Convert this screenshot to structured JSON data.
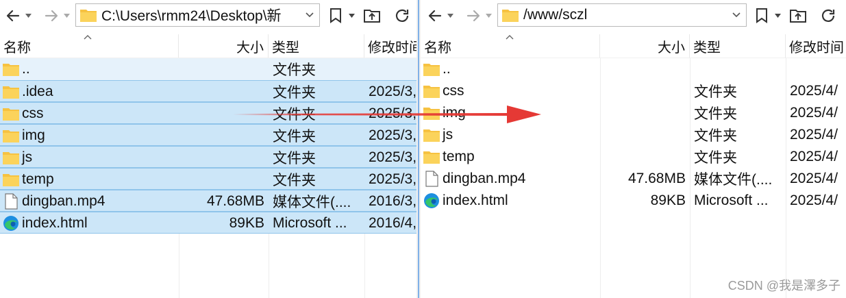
{
  "left": {
    "address": "C:\\Users\\rmm24\\Desktop\\新",
    "columns": {
      "name": "名称",
      "size": "大小",
      "type": "类型",
      "date": "修改时间"
    },
    "rows": [
      {
        "name": "..",
        "size": "",
        "type": "文件夹",
        "date": "",
        "icon": "folder-icon",
        "state": "parent"
      },
      {
        "name": ".idea",
        "size": "",
        "type": "文件夹",
        "date": "2025/3,",
        "icon": "folder-icon",
        "state": "selected"
      },
      {
        "name": "css",
        "size": "",
        "type": "文件夹",
        "date": "2025/3,",
        "icon": "folder-icon",
        "state": "selected"
      },
      {
        "name": "img",
        "size": "",
        "type": "文件夹",
        "date": "2025/3,",
        "icon": "folder-icon",
        "state": "selected"
      },
      {
        "name": "js",
        "size": "",
        "type": "文件夹",
        "date": "2025/3,",
        "icon": "folder-icon",
        "state": "selected"
      },
      {
        "name": "temp",
        "size": "",
        "type": "文件夹",
        "date": "2025/3,",
        "icon": "folder-icon",
        "state": "selected"
      },
      {
        "name": "dingban.mp4",
        "size": "47.68MB",
        "type": "媒体文件(....",
        "date": "2016/3,",
        "icon": "file-icon",
        "state": "selected"
      },
      {
        "name": "index.html",
        "size": "89KB",
        "type": "Microsoft ...",
        "date": "2016/4,",
        "icon": "edge-icon",
        "state": "selected"
      }
    ]
  },
  "right": {
    "address": "/www/sczl",
    "columns": {
      "name": "名称",
      "size": "大小",
      "type": "类型",
      "date": "修改时间"
    },
    "rows": [
      {
        "name": "..",
        "size": "",
        "type": "",
        "date": "",
        "icon": "folder-icon",
        "state": "normal"
      },
      {
        "name": "css",
        "size": "",
        "type": "文件夹",
        "date": "2025/4/",
        "icon": "folder-icon",
        "state": "normal"
      },
      {
        "name": "img",
        "size": "",
        "type": "文件夹",
        "date": "2025/4/",
        "icon": "folder-icon",
        "state": "normal"
      },
      {
        "name": "js",
        "size": "",
        "type": "文件夹",
        "date": "2025/4/",
        "icon": "folder-icon",
        "state": "normal"
      },
      {
        "name": "temp",
        "size": "",
        "type": "文件夹",
        "date": "2025/4/",
        "icon": "folder-icon",
        "state": "normal"
      },
      {
        "name": "dingban.mp4",
        "size": "47.68MB",
        "type": "媒体文件(....",
        "date": "2025/4/",
        "icon": "file-icon",
        "state": "normal"
      },
      {
        "name": "index.html",
        "size": "89KB",
        "type": "Microsoft ...",
        "date": "2025/4/",
        "icon": "edge-icon",
        "state": "normal"
      }
    ]
  },
  "colors": {
    "selection": "#cce6f8",
    "arrow": "#e53935",
    "folder": "#f6c241"
  },
  "watermark": "CSDN @我是澤多子"
}
